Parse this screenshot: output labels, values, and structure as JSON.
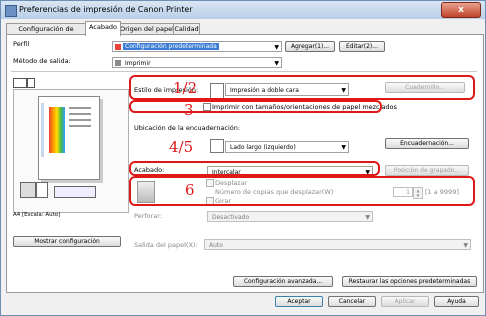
{
  "window": {
    "title": "Preferencias de impresión de Canon Printer",
    "close_glyph": "x"
  },
  "tabs": [
    "Configuración de página",
    "Acabado",
    "Origen del papel",
    "Calidad"
  ],
  "profile": {
    "label": "Perfil",
    "value": "Configuración predeterminada",
    "add_button": "Agregar(1)...",
    "edit_button": "Editar(2)..."
  },
  "output": {
    "label": "Método de salida:",
    "value": "Imprimir"
  },
  "print_style": {
    "label": "Estilo de impresión:",
    "value": "Impresión a doble cara",
    "booklet_button": "Cuadernillo..."
  },
  "mixed_sizes": {
    "label": "Imprimir con tamaños/orientaciones de papel mezclados"
  },
  "binding": {
    "label": "Ubicación de la encuadernación:",
    "value": "Lado largo (izquierdo)",
    "button": "Encuadernación..."
  },
  "finishing": {
    "label": "Acabado:",
    "value": "Intercalar",
    "staple_button": "Posición de grapado..."
  },
  "offset": {
    "label": "Desplazar",
    "copies_label": "Número de copias que desplazar(W)",
    "copies_value": "1",
    "range": "[1 a 9999]"
  },
  "rotate": {
    "label": "Girar"
  },
  "punch": {
    "label": "Perforar:",
    "value": "Desactivado"
  },
  "paper_output": {
    "label": "Salida del papel(X):",
    "value": "Auto"
  },
  "left_panel": {
    "preview_caption": "A4 [Escala: Auto]",
    "show_settings_button": "Mostrar configuración"
  },
  "annotations": {
    "n12": "1/2",
    "n3": "3",
    "n45": "4/5",
    "n6": "6"
  },
  "bottom": {
    "advanced_button": "Configuración avanzada...",
    "restore_button": "Restaurar las opciones predeterminadas"
  },
  "dialog_buttons": {
    "ok": "Aceptar",
    "cancel": "Cancelar",
    "apply": "Aplicar",
    "help": "Ayuda"
  },
  "colors": {
    "annotation_red": "#e01818",
    "selection_blue": "#3a7bd5",
    "title_bar": "#c8dbef"
  }
}
